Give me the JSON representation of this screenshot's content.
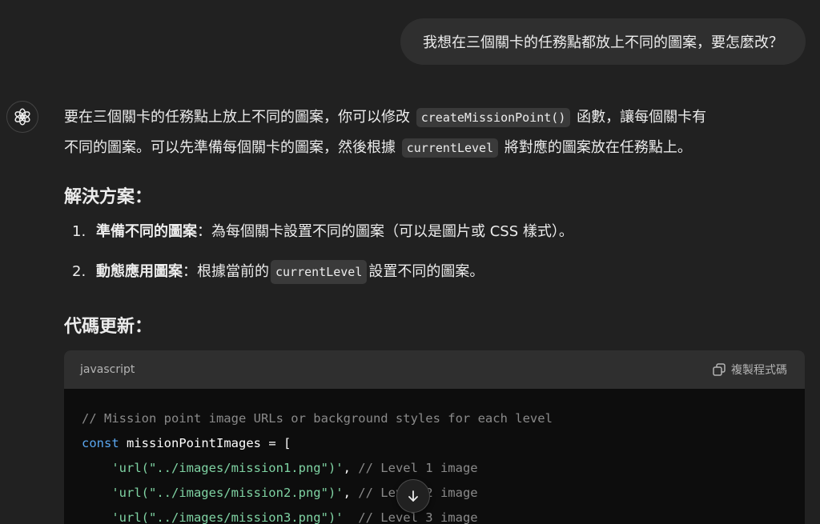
{
  "user_message": "我想在三個關卡的任務點都放上不同的圖案，要怎麼改？",
  "assistant": {
    "avatar_icon": "openai-logo-icon",
    "intro": {
      "p1_a": "要在三個關卡的任務點上放上不同的圖案，你可以修改",
      "p1_code": "createMissionPoint()",
      "p1_b": "函數，讓每個關卡有",
      "p2_a": "不同的圖案。可以先準備每個關卡的圖案，然後根據",
      "p2_code": "currentLevel",
      "p2_b": "將對應的圖案放在任務點上。"
    },
    "heading_solution": "解決方案：",
    "steps": [
      {
        "num": "1.",
        "title": "準備不同的圖案",
        "text": "：為每個關卡設置不同的圖案（可以是圖片或 CSS 樣式）。"
      },
      {
        "num": "2.",
        "title": "動態應用圖案",
        "text_a": "：根據當前的",
        "code": "currentLevel",
        "text_b": "設置不同的圖案。"
      }
    ],
    "heading_code": "代碼更新：",
    "code_block": {
      "language": "javascript",
      "copy_label": "複製程式碼",
      "lines": [
        {
          "comment": "// Mission point image URLs or background styles for each level"
        },
        {
          "keyword": "const",
          "ident": "missionPointImages",
          "rest": " = ["
        },
        {
          "indent": "    ",
          "string": "'url(\"../images/mission1.png\")'",
          "punct": ", ",
          "comment": "// Level 1 image"
        },
        {
          "indent": "    ",
          "string": "'url(\"../images/mission2.png\")'",
          "punct": ", ",
          "comment": "// Level 2 image"
        },
        {
          "indent": "    ",
          "string": "'url(\"../images/mission3.png\")'",
          "punct": "  ",
          "comment": "// Level 3 image"
        }
      ]
    }
  },
  "scroll_button_icon": "arrow-down-icon"
}
